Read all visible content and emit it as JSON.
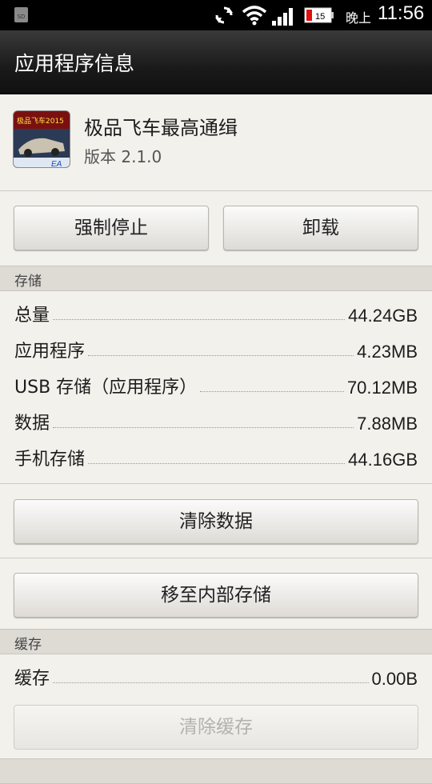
{
  "status_bar": {
    "sd_label": "SD",
    "battery_level": "15",
    "ampm": "晚上",
    "time": "11:56",
    "icons": [
      "sd-card-icon",
      "sync-icon",
      "wifi-icon",
      "signal-icon",
      "battery-icon"
    ]
  },
  "title": "应用程序信息",
  "app": {
    "name": "极品飞车最高通缉",
    "version": "版本 2.1.0",
    "icon_text": "极品飞车2015",
    "icon_badge": "EA"
  },
  "actions": {
    "force_stop": "强制停止",
    "uninstall": "卸载"
  },
  "storage": {
    "header": "存储",
    "rows": [
      {
        "label": "总量",
        "value": "44.24GB"
      },
      {
        "label": "应用程序",
        "value": "4.23MB"
      },
      {
        "label": "USB 存储（应用程序）",
        "value": "70.12MB"
      },
      {
        "label": "数据",
        "value": "7.88MB"
      },
      {
        "label": "手机存储",
        "value": "44.16GB"
      }
    ],
    "clear_data": "清除数据",
    "move_internal": "移至内部存储"
  },
  "cache": {
    "header": "缓存",
    "label": "缓存",
    "value": "0.00B",
    "clear_cache": "清除缓存"
  },
  "colors": {
    "background": "#f3f1ec",
    "section": "#dedbd5",
    "titlebar": "#1a1a1a"
  }
}
